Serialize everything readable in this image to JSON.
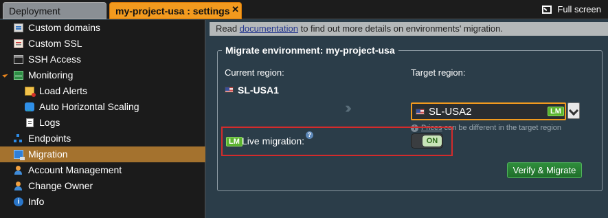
{
  "tabs": {
    "deployment": "Deployment manager",
    "settings": "my-project-usa : settings",
    "close": "✕"
  },
  "toolbar": {
    "fullscreen": "Full screen"
  },
  "sidebar": {
    "items": [
      {
        "label": "Custom domains",
        "icon": "custom-domains-icon"
      },
      {
        "label": "Custom SSL",
        "icon": "ssl-certificate-icon"
      },
      {
        "label": "SSH Access",
        "icon": "terminal-icon"
      },
      {
        "label": "Monitoring",
        "icon": "monitoring-icon",
        "expanded": true
      },
      {
        "label": "Load Alerts",
        "icon": "alert-envelope-icon"
      },
      {
        "label": "Auto Horizontal Scaling",
        "icon": "scaling-icon"
      },
      {
        "label": "Logs",
        "icon": "document-icon"
      },
      {
        "label": "Endpoints",
        "icon": "endpoints-icon"
      },
      {
        "label": "Migration",
        "icon": "migration-icon",
        "active": true
      },
      {
        "label": "Account Management",
        "icon": "users-icon"
      },
      {
        "label": "Change Owner",
        "icon": "change-owner-icon"
      },
      {
        "label": "Info",
        "icon": "info-icon"
      }
    ]
  },
  "info": {
    "prefix": "Read ",
    "link": "documentation",
    "suffix": " to find out more details on environments' migration."
  },
  "migrate": {
    "legend": "Migrate environment: my-project-usa",
    "current_label": "Current region:",
    "current_region": "SL-USA1",
    "target_label": "Target region:",
    "target_region": "SL-USA2",
    "lm_badge": "LM",
    "hint_link": "Prices",
    "hint_text": " can be different in the target region",
    "hint_icon": "i",
    "live_label": "Live migration:",
    "help_icon": "?",
    "toggle_label": "ON",
    "toggle_state": true,
    "verify_button": "Verify & Migrate"
  },
  "colors": {
    "accent": "#f29a1e",
    "active_item": "#a4722e",
    "highlight_border": "#d42b2b",
    "primary_button": "#2f8f3c"
  }
}
